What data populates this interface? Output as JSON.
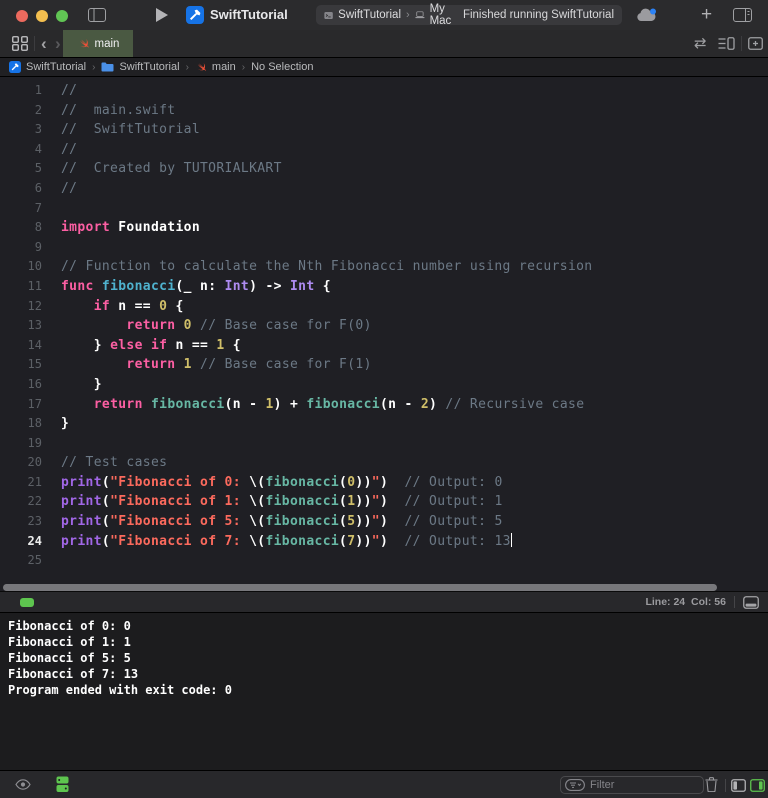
{
  "window": {
    "app_title": "SwiftTutorial"
  },
  "toolbar": {
    "scheme_name": "SwiftTutorial",
    "run_destination": "My Mac",
    "separator": "›",
    "status": "Finished running SwiftTutorial",
    "plus_label": "+"
  },
  "tabbar": {
    "active_tab": "main",
    "back_chevron": "‹",
    "forward_chevron": "›",
    "compare_icon_glyph": "⇄"
  },
  "jumpbar": {
    "separator": "›",
    "items": [
      "SwiftTutorial",
      "SwiftTutorial",
      "main",
      "No Selection"
    ]
  },
  "editor": {
    "cursor_line": 24,
    "lines": [
      {
        "num": 1,
        "tokens": [
          [
            "//",
            "c"
          ]
        ]
      },
      {
        "num": 2,
        "tokens": [
          [
            "//  main.swift",
            "c"
          ]
        ]
      },
      {
        "num": 3,
        "tokens": [
          [
            "//  SwiftTutorial",
            "c"
          ]
        ]
      },
      {
        "num": 4,
        "tokens": [
          [
            "//",
            "c"
          ]
        ]
      },
      {
        "num": 5,
        "tokens": [
          [
            "//  Created by TUTORIALKART",
            "c"
          ]
        ]
      },
      {
        "num": 6,
        "tokens": [
          [
            "//",
            "c"
          ]
        ]
      },
      {
        "num": 7,
        "tokens": []
      },
      {
        "num": 8,
        "tokens": [
          [
            "import",
            "k"
          ],
          [
            " Foundation",
            "p"
          ]
        ]
      },
      {
        "num": 9,
        "tokens": []
      },
      {
        "num": 10,
        "tokens": [
          [
            "// Function to calculate the Nth Fibonacci number using recursion",
            "c"
          ]
        ]
      },
      {
        "num": 11,
        "tokens": [
          [
            "func",
            "k"
          ],
          [
            " ",
            "p"
          ],
          [
            "fibonacci",
            "d"
          ],
          [
            "(_ n: ",
            "p"
          ],
          [
            "Int",
            "t"
          ],
          [
            ") -> ",
            "p"
          ],
          [
            "Int",
            "t"
          ],
          [
            " {",
            "p"
          ]
        ]
      },
      {
        "num": 12,
        "tokens": [
          [
            "    ",
            "p"
          ],
          [
            "if",
            "k"
          ],
          [
            " n == ",
            "p"
          ],
          [
            "0",
            "n"
          ],
          [
            " {",
            "p"
          ]
        ]
      },
      {
        "num": 13,
        "tokens": [
          [
            "        ",
            "p"
          ],
          [
            "return",
            "k"
          ],
          [
            " ",
            "p"
          ],
          [
            "0",
            "n"
          ],
          [
            " ",
            "p"
          ],
          [
            "// Base case for F(0)",
            "c"
          ]
        ]
      },
      {
        "num": 14,
        "tokens": [
          [
            "    } ",
            "p"
          ],
          [
            "else",
            "k"
          ],
          [
            " ",
            "p"
          ],
          [
            "if",
            "k"
          ],
          [
            " n == ",
            "p"
          ],
          [
            "1",
            "n"
          ],
          [
            " {",
            "p"
          ]
        ]
      },
      {
        "num": 15,
        "tokens": [
          [
            "        ",
            "p"
          ],
          [
            "return",
            "k"
          ],
          [
            " ",
            "p"
          ],
          [
            "1",
            "n"
          ],
          [
            " ",
            "p"
          ],
          [
            "// Base case for F(1)",
            "c"
          ]
        ]
      },
      {
        "num": 16,
        "tokens": [
          [
            "    }",
            "p"
          ]
        ]
      },
      {
        "num": 17,
        "tokens": [
          [
            "    ",
            "p"
          ],
          [
            "return",
            "k"
          ],
          [
            " ",
            "p"
          ],
          [
            "fibonacci",
            "f"
          ],
          [
            "(n - ",
            "p"
          ],
          [
            "1",
            "n"
          ],
          [
            ") + ",
            "p"
          ],
          [
            "fibonacci",
            "f"
          ],
          [
            "(n - ",
            "p"
          ],
          [
            "2",
            "n"
          ],
          [
            ") ",
            "p"
          ],
          [
            "// Recursive case",
            "c"
          ]
        ]
      },
      {
        "num": 18,
        "tokens": [
          [
            "}",
            "p"
          ]
        ]
      },
      {
        "num": 19,
        "tokens": []
      },
      {
        "num": 20,
        "tokens": [
          [
            "// Test cases",
            "c"
          ]
        ]
      },
      {
        "num": 21,
        "tokens": [
          [
            "print",
            "pr"
          ],
          [
            "(",
            "p"
          ],
          [
            "\"Fibonacci of 0: ",
            "s"
          ],
          [
            "\\(",
            "p"
          ],
          [
            "fibonacci",
            "f"
          ],
          [
            "(",
            "p"
          ],
          [
            "0",
            "n"
          ],
          [
            "))",
            "p"
          ],
          [
            "\"",
            "s"
          ],
          [
            ")  ",
            "p"
          ],
          [
            "// Output: 0",
            "c"
          ]
        ]
      },
      {
        "num": 22,
        "tokens": [
          [
            "print",
            "pr"
          ],
          [
            "(",
            "p"
          ],
          [
            "\"Fibonacci of 1: ",
            "s"
          ],
          [
            "\\(",
            "p"
          ],
          [
            "fibonacci",
            "f"
          ],
          [
            "(",
            "p"
          ],
          [
            "1",
            "n"
          ],
          [
            "))",
            "p"
          ],
          [
            "\"",
            "s"
          ],
          [
            ")  ",
            "p"
          ],
          [
            "// Output: 1",
            "c"
          ]
        ]
      },
      {
        "num": 23,
        "tokens": [
          [
            "print",
            "pr"
          ],
          [
            "(",
            "p"
          ],
          [
            "\"Fibonacci of 5: ",
            "s"
          ],
          [
            "\\(",
            "p"
          ],
          [
            "fibonacci",
            "f"
          ],
          [
            "(",
            "p"
          ],
          [
            "5",
            "n"
          ],
          [
            "))",
            "p"
          ],
          [
            "\"",
            "s"
          ],
          [
            ")  ",
            "p"
          ],
          [
            "// Output: 5",
            "c"
          ]
        ]
      },
      {
        "num": 24,
        "tokens": [
          [
            "print",
            "pr"
          ],
          [
            "(",
            "p"
          ],
          [
            "\"Fibonacci of 7: ",
            "s"
          ],
          [
            "\\(",
            "p"
          ],
          [
            "fibonacci",
            "f"
          ],
          [
            "(",
            "p"
          ],
          [
            "7",
            "n"
          ],
          [
            "))",
            "p"
          ],
          [
            "\"",
            "s"
          ],
          [
            ")  ",
            "p"
          ],
          [
            "// Output: 13",
            "c"
          ]
        ]
      },
      {
        "num": 25,
        "tokens": []
      }
    ]
  },
  "editor_statusbar": {
    "line_col": "Line: 24  Col: 56"
  },
  "console": {
    "lines": [
      "Fibonacci of 0: 0",
      "Fibonacci of 1: 1",
      "Fibonacci of 5: 5",
      "Fibonacci of 7: 13",
      "Program ended with exit code: 0"
    ]
  },
  "bottom_bar": {
    "filter_placeholder": "Filter"
  },
  "colors": {
    "keyword": "#FC5FA3",
    "string": "#FC6A5D",
    "number": "#D0BF69",
    "comment": "#6C7986",
    "func_decl": "#4FB2CE",
    "func_call": "#67B7A4",
    "type": "#AE8BF2",
    "system_func": "#A167E6",
    "tab_active_bg": "#4A5942",
    "accent_green": "#5EC54F",
    "swift_orange": "#F05138",
    "xcode_blue": "#1673E6"
  }
}
